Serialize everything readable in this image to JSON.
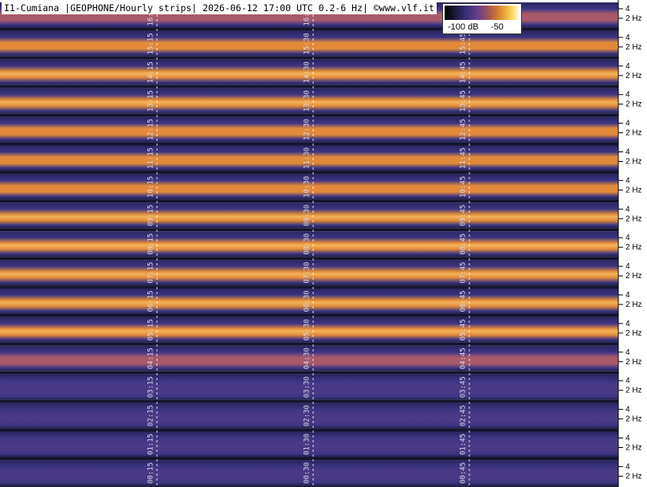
{
  "header": {
    "title": "I1-Cumiana |GEOPHONE/Hourly strips| 2026-06-12 17:00 UTC 0.2-6 Hz| ©www.vlf.it"
  },
  "legend": {
    "min_label": "-100 dB",
    "max_label": "-50"
  },
  "chart_data": {
    "type": "heatmap",
    "title": "I1-Cumiana |GEOPHONE/Hourly strips| 2026-06-12 17:00 UTC 0.2-6 Hz| ©www.vlf.it",
    "colorbar": {
      "min": -100,
      "max": -50,
      "unit": "dB",
      "labels": [
        "-100 dB",
        "-50"
      ]
    },
    "frequency_range_hz": [
      0.2,
      6
    ],
    "y_tick_labels": [
      "4",
      "2 Hz"
    ],
    "strips": [
      {
        "hour": "16",
        "minute_labels": [
          "16:15",
          "16:30",
          "16:45"
        ],
        "intensity": 0.6
      },
      {
        "hour": "15",
        "minute_labels": [
          "15:15",
          "15:30",
          "15:45"
        ],
        "intensity": 0.7
      },
      {
        "hour": "14",
        "minute_labels": [
          "14:15",
          "14:30",
          "14:45"
        ],
        "intensity": 0.8
      },
      {
        "hour": "13",
        "minute_labels": [
          "13:15",
          "13:30",
          "13:45"
        ],
        "intensity": 0.75
      },
      {
        "hour": "12",
        "minute_labels": [
          "12:15",
          "12:30",
          "12:45"
        ],
        "intensity": 0.65
      },
      {
        "hour": "11",
        "minute_labels": [
          "11:15",
          "11:30",
          "11:45"
        ],
        "intensity": 0.7
      },
      {
        "hour": "10",
        "minute_labels": [
          "10:15",
          "10:30",
          "10:45"
        ],
        "intensity": 0.7
      },
      {
        "hour": "09",
        "minute_labels": [
          "09:15",
          "09:30",
          "09:45"
        ],
        "intensity": 0.8
      },
      {
        "hour": "08",
        "minute_labels": [
          "08:15",
          "08:30",
          "08:45"
        ],
        "intensity": 0.85
      },
      {
        "hour": "07",
        "minute_labels": [
          "07:15",
          "07:30",
          "07:45"
        ],
        "intensity": 0.75
      },
      {
        "hour": "06",
        "minute_labels": [
          "06:15",
          "06:30",
          "06:45"
        ],
        "intensity": 0.8
      },
      {
        "hour": "05",
        "minute_labels": [
          "05:15",
          "05:30",
          "05:45"
        ],
        "intensity": 0.75
      },
      {
        "hour": "04",
        "minute_labels": [
          "04:15",
          "04:30",
          "04:45"
        ],
        "intensity": 0.55
      },
      {
        "hour": "03",
        "minute_labels": [
          "03:15",
          "03:30",
          "03:45"
        ],
        "intensity": 0.45
      },
      {
        "hour": "02",
        "minute_labels": [
          "02:15",
          "02:30",
          "02:45"
        ],
        "intensity": 0.3
      },
      {
        "hour": "01",
        "minute_labels": [
          "01:15",
          "01:30",
          "01:45"
        ],
        "intensity": 0.3
      },
      {
        "hour": "00",
        "minute_labels": [
          "00:15",
          "00:30",
          "00:45"
        ],
        "intensity": 0.3
      }
    ],
    "grid": true
  }
}
